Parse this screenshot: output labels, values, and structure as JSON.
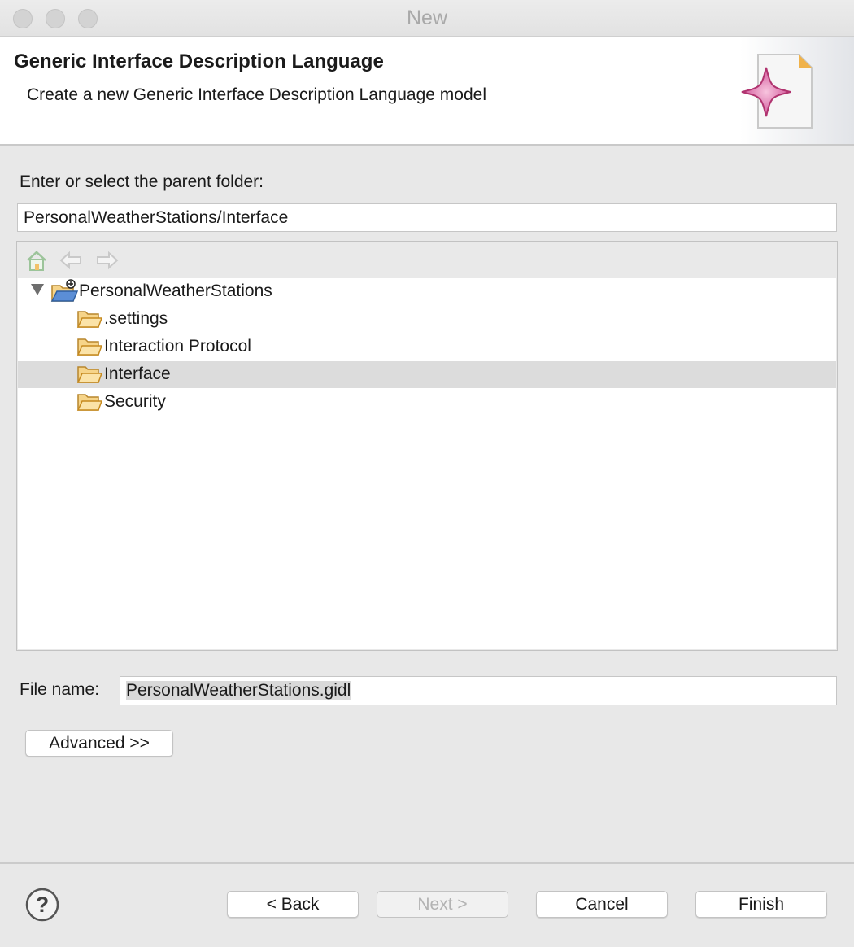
{
  "window": {
    "title": "New"
  },
  "banner": {
    "title": "Generic Interface Description Language",
    "description": "Create a new Generic Interface Description Language model",
    "image_icon": "gidl-wizard-star-image"
  },
  "folder_prompt": "Enter or select the parent folder:",
  "folder_path": "PersonalWeatherStations/Interface",
  "toolbar": {
    "icons": [
      "home-icon",
      "back-arrow-icon",
      "forward-arrow-icon"
    ]
  },
  "tree": {
    "root": {
      "label": "PersonalWeatherStations",
      "icon": "project-folder-icon",
      "expanded": true
    },
    "children": [
      {
        "label": ".settings",
        "icon": "folder-icon",
        "selected": false
      },
      {
        "label": "Interaction Protocol",
        "icon": "folder-icon",
        "selected": false
      },
      {
        "label": "Interface",
        "icon": "folder-icon",
        "selected": true
      },
      {
        "label": "Security",
        "icon": "folder-icon",
        "selected": false
      }
    ]
  },
  "file_name": {
    "label": "File name:",
    "value": "PersonalWeatherStations.gidl"
  },
  "buttons": {
    "advanced": "Advanced >>",
    "back": "< Back",
    "next": "Next >",
    "cancel": "Cancel",
    "finish": "Finish"
  },
  "help_icon": "help-icon",
  "colors": {
    "folder": "#e8a73a",
    "selection": "#dcdcdc",
    "banner_star": "#d2519a"
  }
}
